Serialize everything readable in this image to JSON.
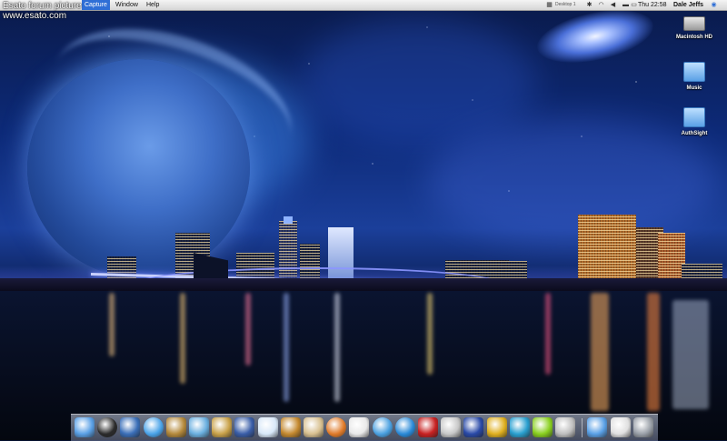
{
  "watermark": {
    "line1": "Esato forum picture",
    "line2": "www.esato.com"
  },
  "menubar": {
    "menus": [
      {
        "label": "Capture",
        "active": true
      },
      {
        "label": "Window",
        "active": false
      },
      {
        "label": "Help",
        "active": false
      }
    ],
    "status": {
      "desktop_switcher": "Desktop 1",
      "clock": "Thu 22:58",
      "user": "Dale Jeffs"
    }
  },
  "desktop_icons": [
    {
      "label": "Macintosh HD",
      "icon": "hard-drive-icon"
    },
    {
      "label": "Music",
      "icon": "folder-icon"
    },
    {
      "label": "AuthSight",
      "icon": "folder-icon"
    }
  ],
  "dock": {
    "items": [
      {
        "name": "finder-icon",
        "color": "#5aa0e6"
      },
      {
        "name": "dashboard-icon",
        "color": "#2b2b2b"
      },
      {
        "name": "preview-icon",
        "color": "#3b6fb8"
      },
      {
        "name": "safari-icon",
        "color": "#4aa3e8"
      },
      {
        "name": "address-book-icon",
        "color": "#b58a3c"
      },
      {
        "name": "itunes-icon",
        "color": "#6bb0e0"
      },
      {
        "name": "iphoto-icon",
        "color": "#c9a24a"
      },
      {
        "name": "imovie-icon",
        "color": "#3a5ea8"
      },
      {
        "name": "ical-icon",
        "color": "#d8e8f8"
      },
      {
        "name": "garageband-icon",
        "color": "#c58a30"
      },
      {
        "name": "textedit-icon",
        "color": "#d8c090"
      },
      {
        "name": "firefox-icon",
        "color": "#e07b2a"
      },
      {
        "name": "calendar-icon",
        "color": "#e9e9e9"
      },
      {
        "name": "quicktime-icon",
        "color": "#4aa0e0"
      },
      {
        "name": "refresh-icon",
        "color": "#2a8ad8"
      },
      {
        "name": "photobooth-icon",
        "color": "#c82222"
      },
      {
        "name": "apple-icon",
        "color": "#c8c8c8"
      },
      {
        "name": "automator-icon",
        "color": "#2a4aa8"
      },
      {
        "name": "messenger-icon",
        "color": "#e0b020"
      },
      {
        "name": "buddies-icon",
        "color": "#2aa0d0"
      },
      {
        "name": "app-green-icon",
        "color": "#8ad020"
      },
      {
        "name": "preferences-icon",
        "color": "#bfbfbf"
      },
      {
        "name": "applications-folder-icon",
        "color": "#5aa0e6"
      },
      {
        "name": "document-icon",
        "color": "#e0e0e0"
      },
      {
        "name": "trash-icon",
        "color": "#9aa0a8"
      }
    ]
  }
}
